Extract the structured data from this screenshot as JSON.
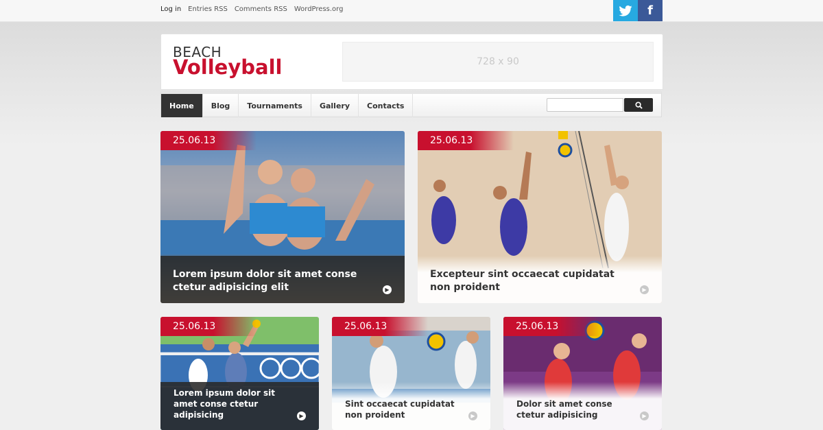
{
  "topbar": {
    "links": [
      "Log in",
      "Entries RSS",
      "Comments RSS",
      "WordPress.org"
    ],
    "social": [
      {
        "label": "t",
        "icon": "twitter-icon",
        "color": "#27a9e1"
      },
      {
        "label": "f",
        "icon": "facebook-icon",
        "color": "#3b5998"
      }
    ]
  },
  "header": {
    "logo_line1": "BEACH",
    "logo_line2": "Volleyball",
    "banner_text": "728 x 90"
  },
  "nav": {
    "items": [
      "Home",
      "Blog",
      "Tournaments",
      "Gallery",
      "Contacts"
    ],
    "active": "Home"
  },
  "search": {
    "placeholder": ""
  },
  "posts": [
    {
      "date": "25.06.13",
      "title": "Lorem ipsum dolor sit amet conse ctetur adipisicing elit"
    },
    {
      "date": "25.06.13",
      "title": "Excepteur sint occaecat cupidatat non proident"
    },
    {
      "date": "25.06.13",
      "title": "Lorem ipsum dolor sit amet conse ctetur adipisicing"
    },
    {
      "date": "25.06.13",
      "title": "Sint occaecat cupidatat non proident"
    },
    {
      "date": "25.06.13",
      "title": "Dolor sit amet conse ctetur adipisicing"
    }
  ],
  "colors": {
    "accent": "#c8102e",
    "nav_active": "#333333"
  }
}
